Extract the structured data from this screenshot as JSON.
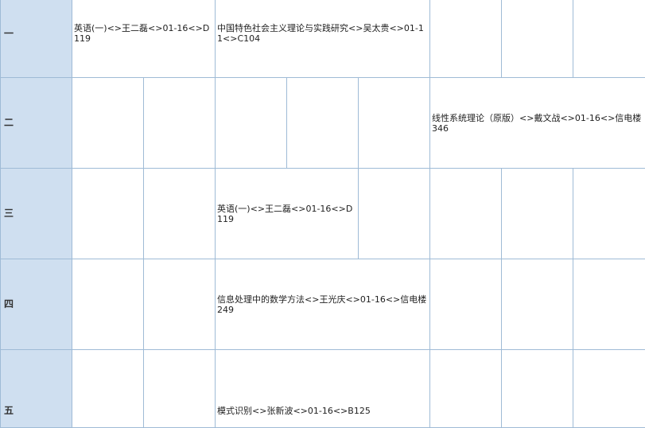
{
  "days": [
    "一",
    "二",
    "三",
    "四",
    "五"
  ],
  "courses": {
    "mon_morning_1": "英语(一)<>王二磊<>01-16<>D119",
    "mon_morning_2": "中国特色社会主义理论与实践研究<>吴太贵<>01-11<>C104",
    "tue_evening": "线性系统理论（原版）<>戴文战<>01-16<>信电楼346",
    "wed_morning_2": "英语(一)<>王二磊<>01-16<>D119",
    "thu_morning_2": "信息处理中的数学方法<>王光庆<>01-16<>信电楼249",
    "fri_morning_2": "模式识别<>张新波<>01-16<>B125"
  },
  "colors": {
    "day_header_bg": "#cfdff0",
    "grid_line": "#9fbbd6"
  }
}
